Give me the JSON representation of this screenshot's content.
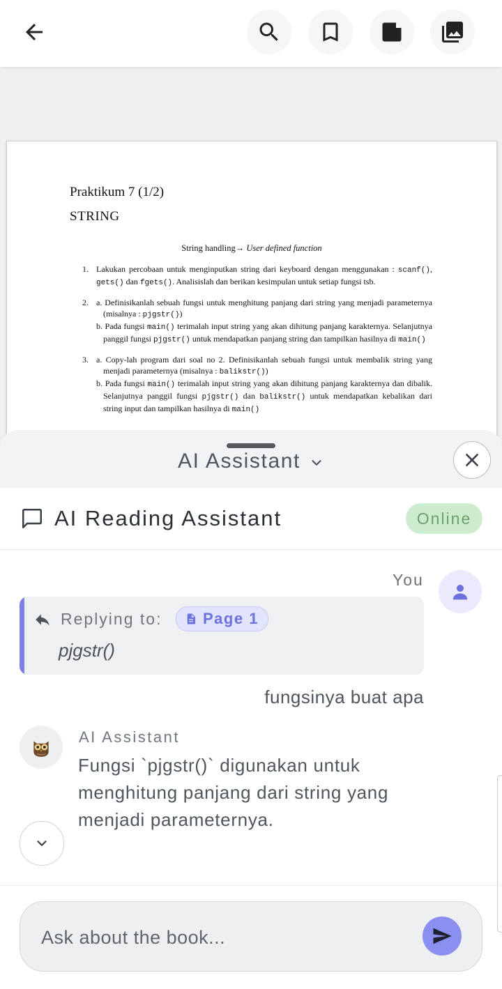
{
  "toolbar": {
    "back_icon": "arrow-left-icon",
    "search_icon": "search-icon",
    "bookmark_icon": "bookmark-icon",
    "note_icon": "note-icon",
    "gallery_icon": "gallery-icon"
  },
  "document": {
    "title": "Praktikum 7 (1/2)",
    "subtitle": "STRING",
    "heading_prefix": "String handling",
    "heading_arrow": "→",
    "heading_italic": "User defined function",
    "items": [
      {
        "num": "1.",
        "parts": [
          {
            "t": "Lakukan percobaan untuk menginputkan string dari keyboard dengan menggunakan : "
          },
          {
            "t": "scanf()",
            "mono": true
          },
          {
            "t": ", "
          },
          {
            "t": "gets()",
            "mono": true
          },
          {
            "t": " dan "
          },
          {
            "t": "fgets()",
            "mono": true
          },
          {
            "t": ". Analisislah dan berikan kesimpulan untuk setiap fungsi tsb."
          }
        ]
      },
      {
        "num": "2.",
        "subs": [
          [
            {
              "t": "a. Definisikanlah sebuah fungsi untuk menghitung panjang dari string yang menjadi parameternya (misalnya : "
            },
            {
              "t": "pjgstr()",
              "mono": true
            },
            {
              "t": ")"
            }
          ],
          [
            {
              "t": "b. Pada fungsi "
            },
            {
              "t": "main()",
              "mono": true
            },
            {
              "t": " terimalah input string yang akan dihitung panjang karakternya. Selanjutnya panggil fungsi "
            },
            {
              "t": "pjgstr()",
              "mono": true
            },
            {
              "t": " untuk mendapatkan panjang string dan tampilkan hasilnya di "
            },
            {
              "t": "main()",
              "mono": true
            }
          ]
        ]
      },
      {
        "num": "3.",
        "subs": [
          [
            {
              "t": "a. Copy-lah program dari soal no 2. Definisikanlah sebuah fungsi untuk membalik string yang menjadi parameternya (misalnya : "
            },
            {
              "t": "balikstr()",
              "mono": true
            },
            {
              "t": ")"
            }
          ],
          [
            {
              "t": "b. Pada fungsi "
            },
            {
              "t": "main()",
              "mono": true
            },
            {
              "t": " terimalah input string yang akan dihitung panjang karakternya dan dibalik. Selanjutnya panggil fungsi "
            },
            {
              "t": "pjgstr()",
              "mono": true
            },
            {
              "t": " dan "
            },
            {
              "t": "balikstr()",
              "mono": true
            },
            {
              "t": " untuk mendapatkan kebalikan dari string input dan tampilkan hasilnya di "
            },
            {
              "t": "main()",
              "mono": true
            }
          ]
        ]
      }
    ]
  },
  "sheet": {
    "title": "AI Assistant",
    "close_icon": "close-icon",
    "dropdown_icon": "chevron-down-icon"
  },
  "assistant": {
    "title": "AI Reading Assistant",
    "status": "Online",
    "status_color": "#6aa16e"
  },
  "chat": {
    "you_label": "You",
    "reply_label": "Replying to:",
    "page_chip": "Page 1",
    "quoted_text": "pjgstr()",
    "user_message": "fungsinya buat apa",
    "ai_label": "AI Assistant",
    "ai_message": "Fungsi `pjgstr()` digunakan untuk menghitung panjang dari string yang menjadi parameternya."
  },
  "input": {
    "placeholder": "Ask about the book...",
    "send_icon": "send-icon"
  },
  "colors": {
    "accent": "#8a8ff0",
    "reply_bar": "#7b81e6",
    "online_bg": "#cdeccd"
  }
}
